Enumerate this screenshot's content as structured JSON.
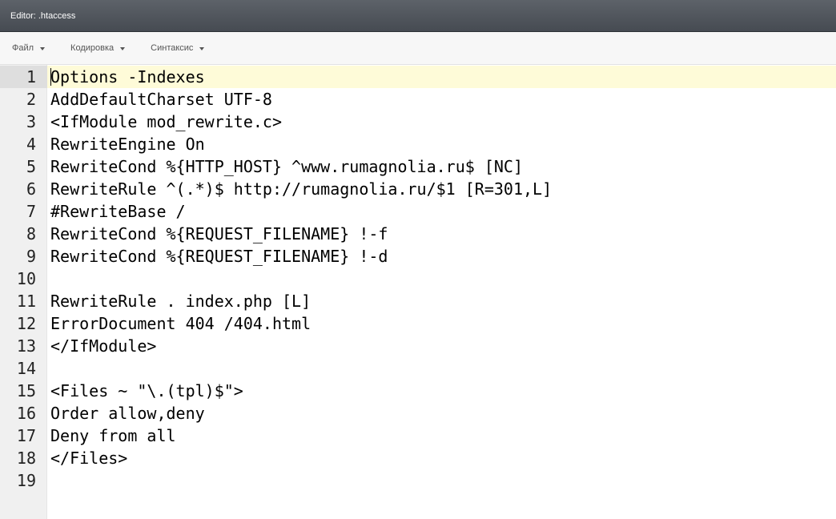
{
  "window": {
    "title": "Editor: .htaccess"
  },
  "menu": {
    "items": [
      {
        "label": "Файл"
      },
      {
        "label": "Кодировка"
      },
      {
        "label": "Синтаксис"
      }
    ]
  },
  "editor": {
    "active_line": 1,
    "lines": [
      {
        "num": "1",
        "text": "Options -Indexes"
      },
      {
        "num": "2",
        "text": "AddDefaultCharset UTF-8"
      },
      {
        "num": "3",
        "text": "<IfModule mod_rewrite.c>"
      },
      {
        "num": "4",
        "text": "RewriteEngine On"
      },
      {
        "num": "5",
        "text": "RewriteCond %{HTTP_HOST} ^www.rumagnolia.ru$ [NC]"
      },
      {
        "num": "6",
        "text": "RewriteRule ^(.*)$ http://rumagnolia.ru/$1 [R=301,L]"
      },
      {
        "num": "7",
        "text": "#RewriteBase /"
      },
      {
        "num": "8",
        "text": "RewriteCond %{REQUEST_FILENAME} !-f"
      },
      {
        "num": "9",
        "text": "RewriteCond %{REQUEST_FILENAME} !-d"
      },
      {
        "num": "10",
        "text": ""
      },
      {
        "num": "11",
        "text": "RewriteRule . index.php [L]"
      },
      {
        "num": "12",
        "text": "ErrorDocument 404 /404.html"
      },
      {
        "num": "13",
        "text": "</IfModule>"
      },
      {
        "num": "14",
        "text": ""
      },
      {
        "num": "15",
        "text": "<Files ~ \"\\.(tpl)$\">"
      },
      {
        "num": "16",
        "text": "Order allow,deny"
      },
      {
        "num": "17",
        "text": "Deny from all"
      },
      {
        "num": "18",
        "text": "</Files>"
      },
      {
        "num": "19",
        "text": ""
      }
    ]
  }
}
